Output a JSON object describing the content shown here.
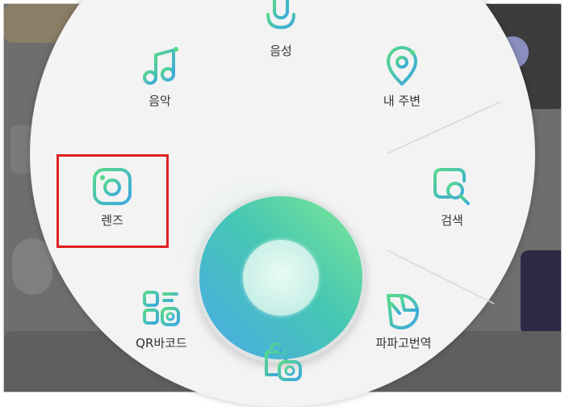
{
  "search_wheel": {
    "items": [
      {
        "label": "음성",
        "icon": "microphone-icon"
      },
      {
        "label": "음악",
        "icon": "music-note-icon"
      },
      {
        "label": "내 주변",
        "icon": "location-pin-icon"
      },
      {
        "label": "렌즈",
        "icon": "lens-camera-icon"
      },
      {
        "label": "검색",
        "icon": "search-icon"
      },
      {
        "label": "QR바코드",
        "icon": "qr-barcode-icon"
      },
      {
        "label": "파파고번역",
        "icon": "papago-translate-icon"
      },
      {
        "label": "",
        "icon": "shopping-lens-icon"
      }
    ],
    "center_button": "green-center-button",
    "highlighted_item": "렌즈"
  },
  "colors": {
    "icon_gradient_start": "#4fd08a",
    "icon_gradient_end": "#3aa8e0",
    "highlight_border": "#e0201f",
    "center_gradient_top": "#7fe895",
    "center_gradient_bottom": "#4aa9e8"
  }
}
